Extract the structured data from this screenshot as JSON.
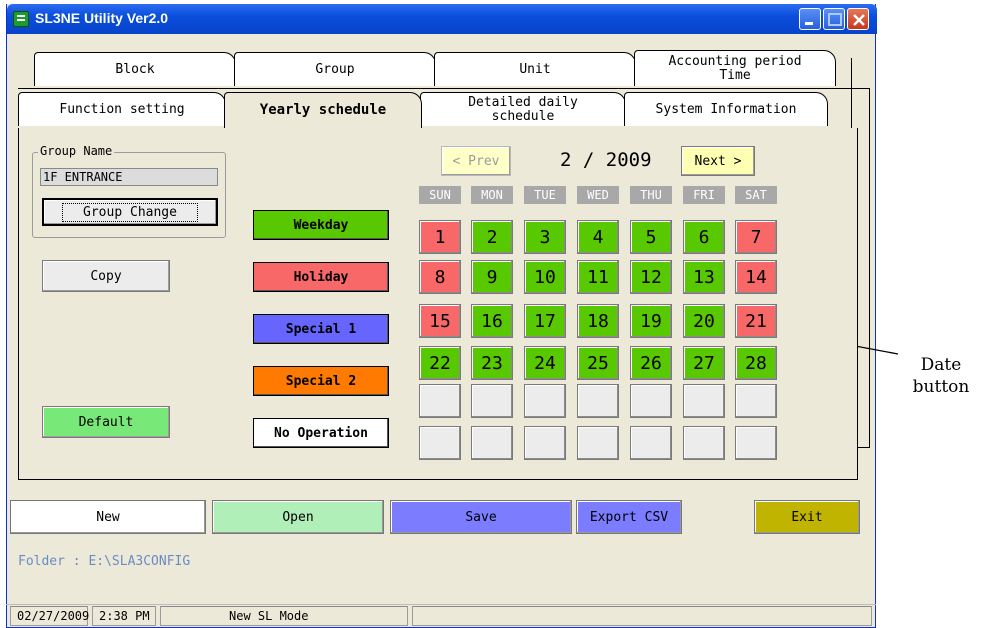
{
  "window": {
    "title": "SL3NE Utility Ver2.0"
  },
  "tabs": {
    "row1": [
      "Block",
      "Group",
      "Unit",
      "Accounting period\nTime"
    ],
    "row2": [
      "Function setting",
      "Yearly schedule",
      "Detailed daily\nschedule",
      "System Information"
    ],
    "active": "Yearly schedule"
  },
  "group": {
    "box_label": "Group Name",
    "name_value": "1F ENTRANCE",
    "change_label": "Group Change",
    "copy_label": "Copy",
    "default_label": "Default"
  },
  "day_types": [
    {
      "label": "Weekday",
      "color": "#58c800"
    },
    {
      "label": "Holiday",
      "color": "#f86868"
    },
    {
      "label": "Special 1",
      "color": "#6666ff"
    },
    {
      "label": "Special 2",
      "color": "#ff7a00"
    },
    {
      "label": "No Operation",
      "color": "#ffffff"
    }
  ],
  "calendar": {
    "prev_label": "< Prev",
    "next_label": "Next >",
    "month_label": "2 / 2009",
    "weekdays": [
      "SUN",
      "MON",
      "TUE",
      "WED",
      "THU",
      "FRI",
      "SAT"
    ],
    "weekday_color": "#a8a8a8",
    "weekday_text_color": "#ffffff",
    "empty_color": "#ececec",
    "weeks": [
      [
        {
          "d": "1",
          "t": "holiday"
        },
        {
          "d": "2",
          "t": "weekday"
        },
        {
          "d": "3",
          "t": "weekday"
        },
        {
          "d": "4",
          "t": "weekday"
        },
        {
          "d": "5",
          "t": "weekday"
        },
        {
          "d": "6",
          "t": "weekday"
        },
        {
          "d": "7",
          "t": "holiday"
        }
      ],
      [
        {
          "d": "8",
          "t": "holiday"
        },
        {
          "d": "9",
          "t": "weekday"
        },
        {
          "d": "10",
          "t": "weekday"
        },
        {
          "d": "11",
          "t": "weekday"
        },
        {
          "d": "12",
          "t": "weekday"
        },
        {
          "d": "13",
          "t": "weekday"
        },
        {
          "d": "14",
          "t": "holiday"
        }
      ],
      [
        {
          "d": "15",
          "t": "holiday"
        },
        {
          "d": "16",
          "t": "weekday"
        },
        {
          "d": "17",
          "t": "weekday"
        },
        {
          "d": "18",
          "t": "weekday"
        },
        {
          "d": "19",
          "t": "weekday"
        },
        {
          "d": "20",
          "t": "weekday"
        },
        {
          "d": "21",
          "t": "holiday"
        }
      ],
      [
        {
          "d": "22",
          "t": "weekday"
        },
        {
          "d": "23",
          "t": "weekday"
        },
        {
          "d": "24",
          "t": "weekday"
        },
        {
          "d": "25",
          "t": "weekday"
        },
        {
          "d": "26",
          "t": "weekday"
        },
        {
          "d": "27",
          "t": "weekday"
        },
        {
          "d": "28",
          "t": "weekday"
        }
      ],
      [
        {
          "d": "",
          "t": "empty"
        },
        {
          "d": "",
          "t": "empty"
        },
        {
          "d": "",
          "t": "empty"
        },
        {
          "d": "",
          "t": "empty"
        },
        {
          "d": "",
          "t": "empty"
        },
        {
          "d": "",
          "t": "empty"
        },
        {
          "d": "",
          "t": "empty"
        }
      ],
      [
        {
          "d": "",
          "t": "empty"
        },
        {
          "d": "",
          "t": "empty"
        },
        {
          "d": "",
          "t": "empty"
        },
        {
          "d": "",
          "t": "empty"
        },
        {
          "d": "",
          "t": "empty"
        },
        {
          "d": "",
          "t": "empty"
        },
        {
          "d": "",
          "t": "empty"
        }
      ]
    ]
  },
  "toolbar": {
    "buttons": [
      {
        "label": "New",
        "color": "#ffffff"
      },
      {
        "label": "Open",
        "color": "#b0f0b8"
      },
      {
        "label": "Save",
        "color": "#7c7cff"
      },
      {
        "label": "Export CSV",
        "color": "#7c7cff"
      },
      {
        "label": "Exit",
        "color": "#c0b400"
      }
    ]
  },
  "folder_text": "Folder : E:\\SLA3CONFIG",
  "status": {
    "date": "02/27/2009",
    "time": "2:38 PM",
    "mode": "New SL Mode"
  },
  "annotation": {
    "text": "Date\nbutton"
  }
}
